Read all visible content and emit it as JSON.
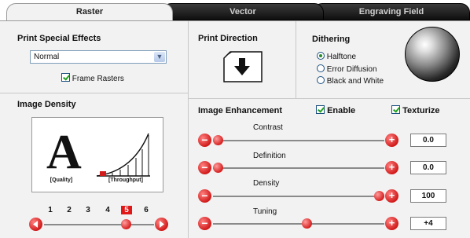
{
  "tabs": [
    {
      "label": "Raster",
      "active": true
    },
    {
      "label": "Vector",
      "active": false
    },
    {
      "label": "Engraving Field",
      "active": false
    }
  ],
  "raster": {
    "print_special_effects": {
      "title": "Print Special Effects",
      "dropdown_value": "Normal",
      "frame_rasters_label": "Frame Rasters",
      "frame_rasters_checked": true
    },
    "image_density": {
      "title": "Image Density",
      "quality_glyph": "A",
      "quality_label": "[Quality]",
      "throughput_label": "[Throughput]",
      "levels": [
        "1",
        "2",
        "3",
        "4",
        "5",
        "6"
      ],
      "selected_level": "5"
    },
    "print_direction": {
      "title": "Print Direction"
    },
    "dithering": {
      "title": "Dithering",
      "options": [
        {
          "label": "Halftone",
          "selected": true
        },
        {
          "label": "Error Diffusion",
          "selected": false
        },
        {
          "label": "Black and White",
          "selected": false
        }
      ]
    },
    "image_enhancement": {
      "title": "Image Enhancement",
      "enable_label": "Enable",
      "enable_checked": true,
      "texturize_label": "Texturize",
      "texturize_checked": true,
      "sliders": [
        {
          "label": "Contrast",
          "value": "0.0",
          "fraction": 0.0
        },
        {
          "label": "Definition",
          "value": "0.0",
          "fraction": 0.0
        },
        {
          "label": "Density",
          "value": "100",
          "fraction": 1.0
        },
        {
          "label": "Tuning",
          "value": "+4",
          "fraction": 0.55
        }
      ]
    }
  },
  "colors": {
    "accent_red": "#d11a1a",
    "tab_dark": "#1a1a1a",
    "check_green": "#21a121"
  }
}
